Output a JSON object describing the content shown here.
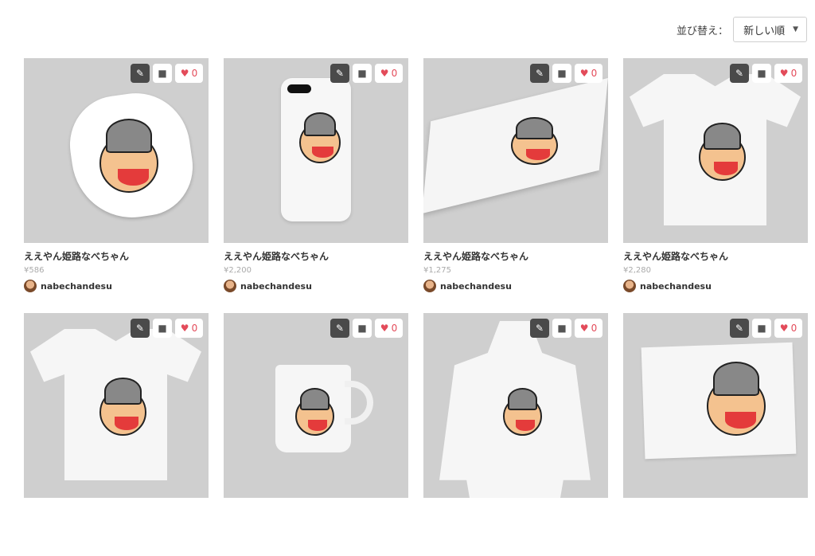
{
  "sort": {
    "label": "並び替え：",
    "selected": "新しい順"
  },
  "products": [
    {
      "title": "ええやん姫路なべちゃん",
      "price": "¥586",
      "user": "nabechandesu",
      "likes": "0",
      "type": "sticker"
    },
    {
      "title": "ええやん姫路なべちゃん",
      "price": "¥2,200",
      "user": "nabechandesu",
      "likes": "0",
      "type": "phone"
    },
    {
      "title": "ええやん姫路なべちゃん",
      "price": "¥1,275",
      "user": "nabechandesu",
      "likes": "0",
      "type": "notebook"
    },
    {
      "title": "ええやん姫路なべちゃん",
      "price": "¥2,280",
      "user": "nabechandesu",
      "likes": "0",
      "type": "tshirt"
    },
    {
      "title": "",
      "price": "",
      "user": "",
      "likes": "0",
      "type": "tshirt"
    },
    {
      "title": "",
      "price": "",
      "user": "",
      "likes": "0",
      "type": "mug"
    },
    {
      "title": "",
      "price": "",
      "user": "",
      "likes": "0",
      "type": "hoodie"
    },
    {
      "title": "",
      "price": "",
      "user": "",
      "likes": "0",
      "type": "towel"
    }
  ],
  "icons": {
    "edit": "pencil-icon",
    "folder": "folder-icon",
    "like": "heart-icon"
  }
}
